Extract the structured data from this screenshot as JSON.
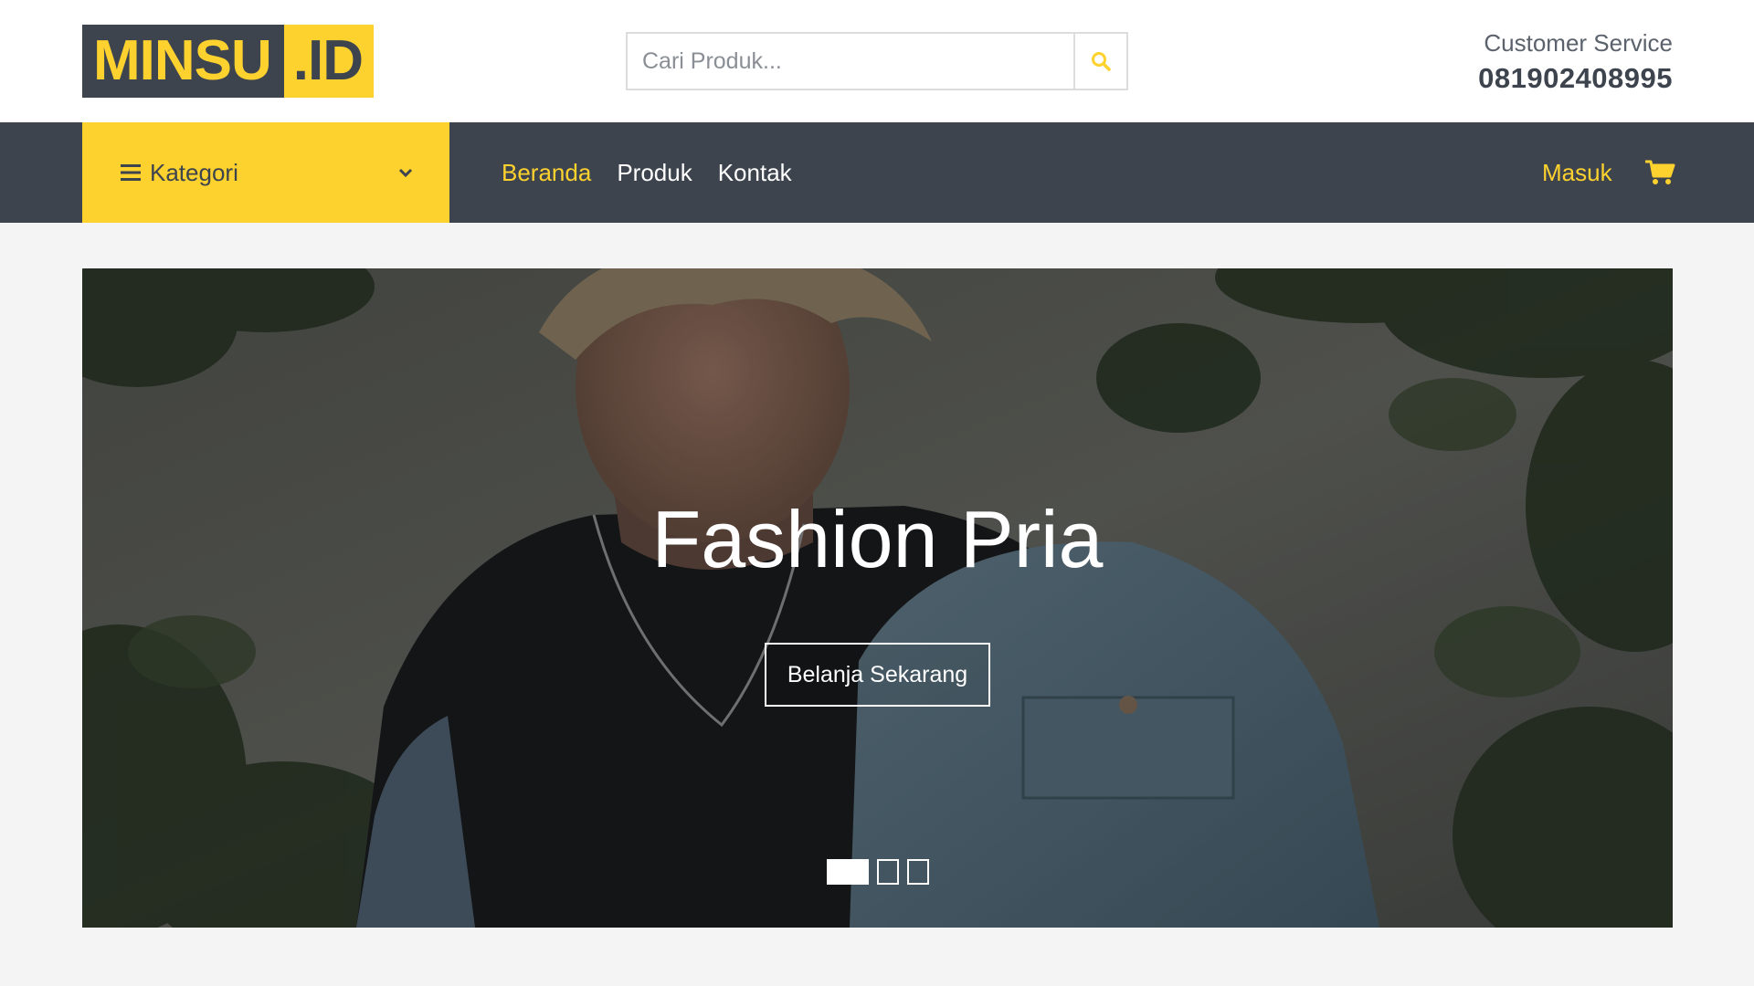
{
  "brand": {
    "main": "MINSU",
    "ext": ".ID"
  },
  "search": {
    "placeholder": "Cari Produk..."
  },
  "customer_service": {
    "label": "Customer Service",
    "phone": "081902408995"
  },
  "nav": {
    "kategori_label": "Kategori",
    "links": [
      {
        "label": "Beranda",
        "active": true
      },
      {
        "label": "Produk",
        "active": false
      },
      {
        "label": "Kontak",
        "active": false
      }
    ],
    "login_label": "Masuk"
  },
  "hero": {
    "title": "Fashion Pria",
    "cta_label": "Belanja Sekarang",
    "slides_count": 3,
    "active_slide": 1
  },
  "colors": {
    "accent": "#fdd12e",
    "dark": "#3d444e",
    "background": "#f4f4f4"
  },
  "icons": {
    "search": "search-icon",
    "menu": "hamburger-icon",
    "dropdown": "chevron-down-icon",
    "cart": "cart-icon"
  }
}
